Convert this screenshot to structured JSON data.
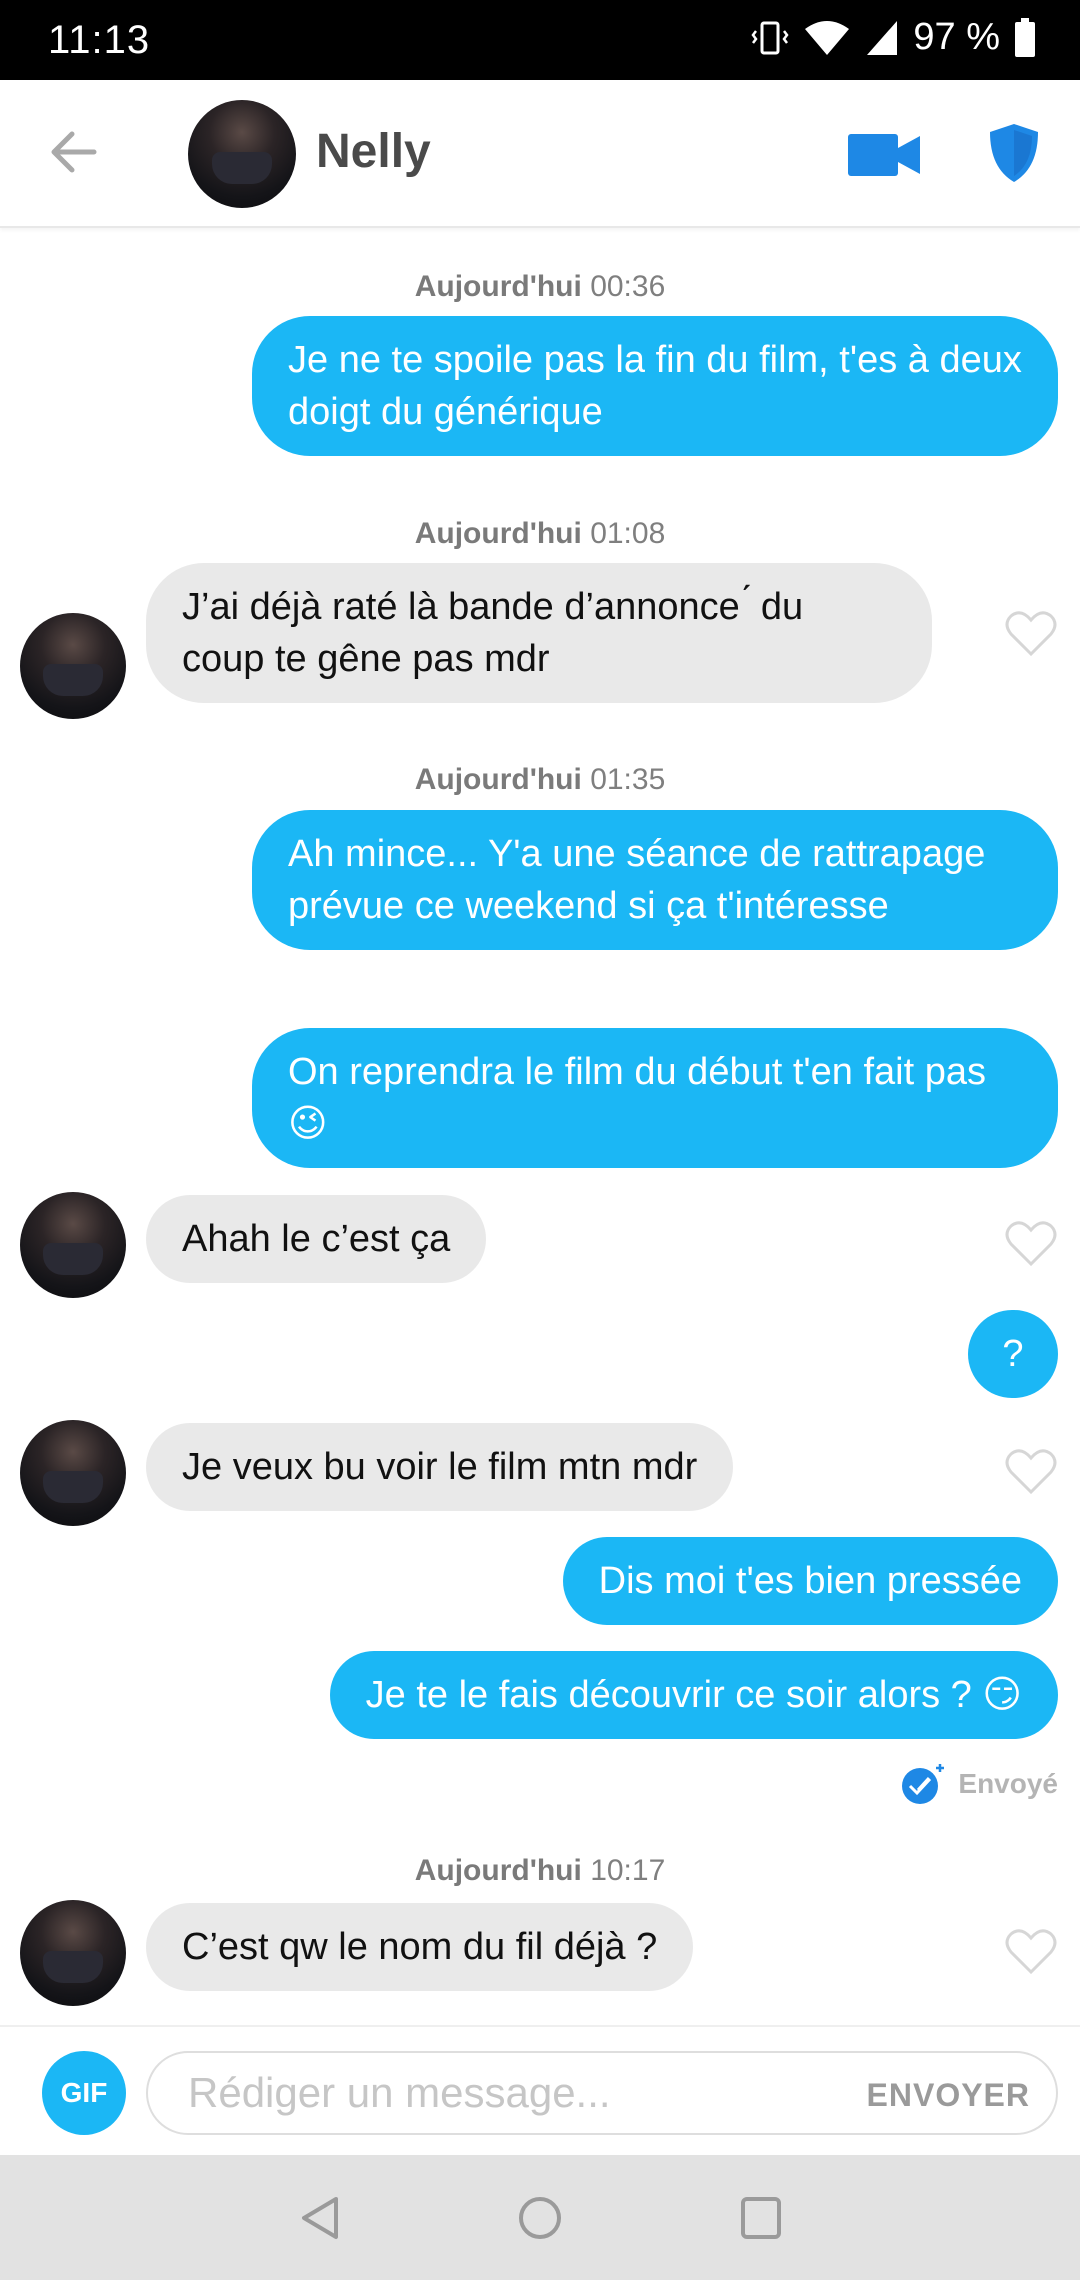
{
  "status_bar": {
    "time": "11:13",
    "battery": "97 %"
  },
  "header": {
    "contact_name": "Nelly"
  },
  "messages": [
    {
      "type": "timestamp",
      "day": "Aujourd'hui",
      "time": "00:36"
    },
    {
      "type": "out",
      "text": "Je ne te spoile pas la fin du film, t'es à deux doigt du générique"
    },
    {
      "type": "timestamp",
      "day": "Aujourd'hui",
      "time": "01:08"
    },
    {
      "type": "in",
      "text": "J’ai déjà raté là bande d’annonce ́ du coup te gêne pas mdr"
    },
    {
      "type": "timestamp",
      "day": "Aujourd'hui",
      "time": "01:35"
    },
    {
      "type": "out",
      "text": "Ah mince... Y'a une séance de rattrapage prévue ce weekend si ça t'intéresse"
    },
    {
      "type": "out",
      "text": "On reprendra le film du début t'en fait pas 😉"
    },
    {
      "type": "in",
      "text": "Ahah le c’est ça"
    },
    {
      "type": "out",
      "text": "?"
    },
    {
      "type": "in",
      "text": "Je veux bu voir le film mtn mdr"
    },
    {
      "type": "out",
      "text": "Dis moi t'es bien pressée"
    },
    {
      "type": "out",
      "text": "Je te le fais découvrir ce soir alors ? 😏"
    },
    {
      "type": "status",
      "text": "Envoyé"
    },
    {
      "type": "timestamp",
      "day": "Aujourd'hui",
      "time": "10:17"
    },
    {
      "type": "in",
      "text": "C’est qw le nom du fil déjà ?"
    }
  ],
  "composer": {
    "gif_label": "GIF",
    "placeholder": "Rédiger un message...",
    "send_label": "ENVOYER"
  },
  "colors": {
    "accent": "#1bb7f5",
    "incoming_bubble": "#e9e9e9",
    "header_icons": "#1e88e5"
  },
  "icons": [
    "back-arrow-icon",
    "video-call-icon",
    "shield-icon",
    "heart-icon",
    "sent-check-icon",
    "back-nav-icon",
    "home-nav-icon",
    "recents-nav-icon"
  ]
}
